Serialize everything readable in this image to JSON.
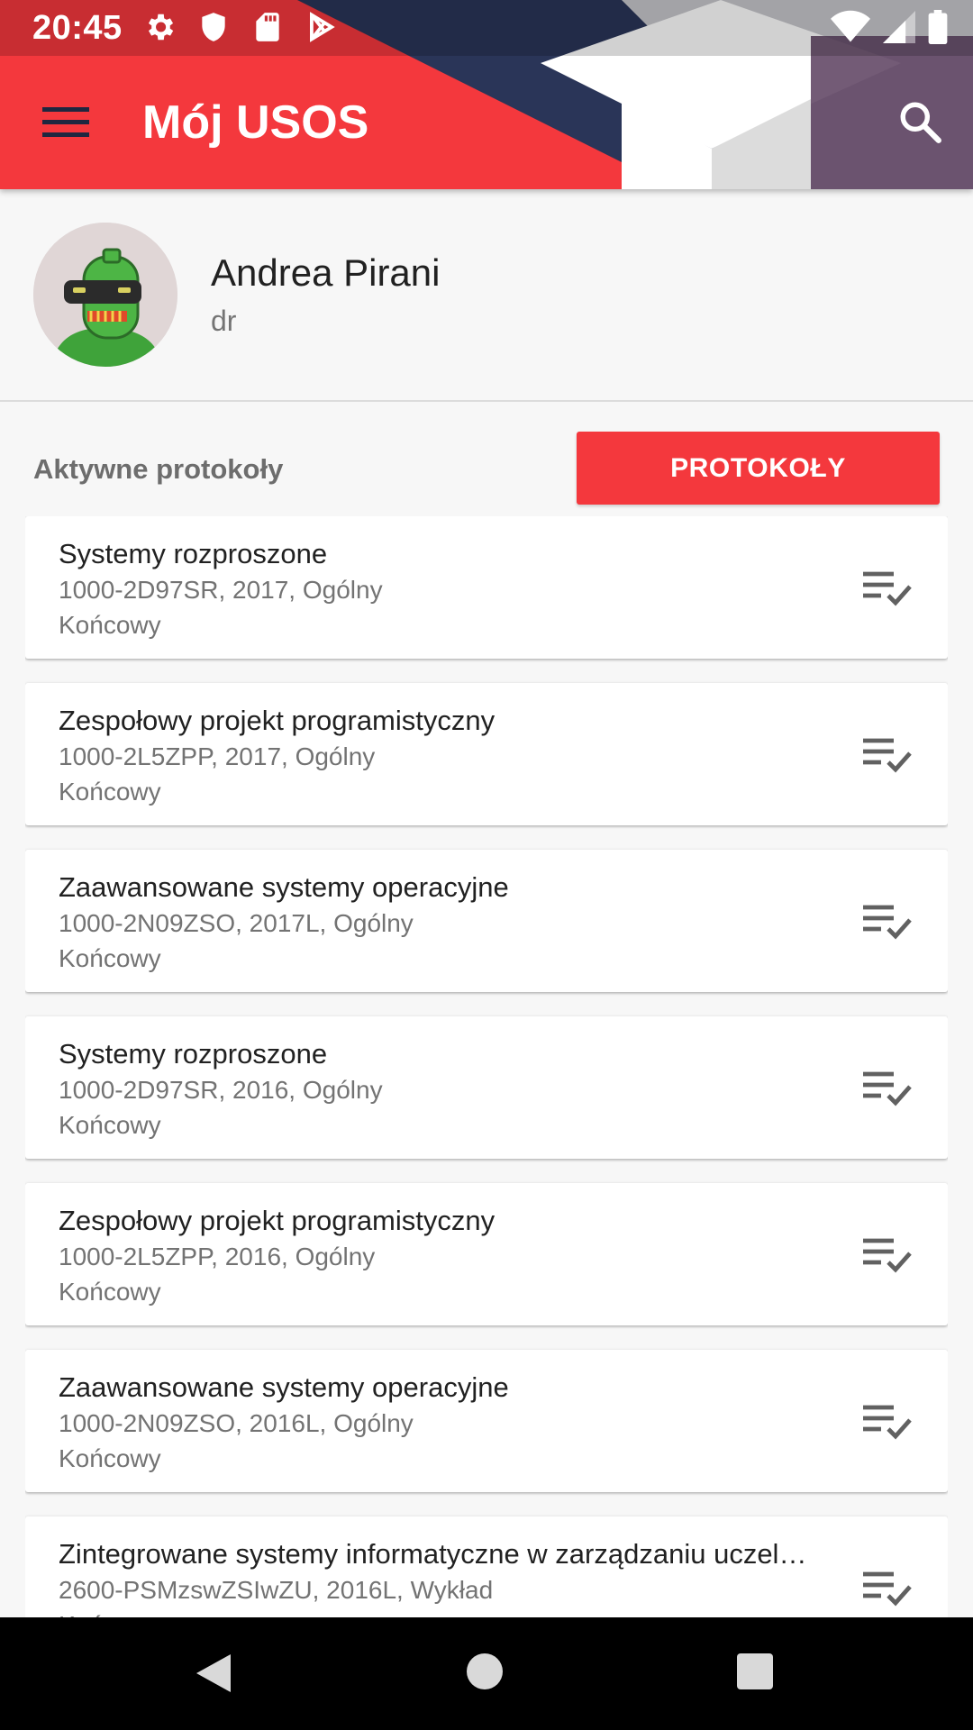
{
  "status_bar": {
    "time": "20:45",
    "icons_left": [
      "settings-icon",
      "shield-icon",
      "sd-card-icon",
      "play-store-icon"
    ],
    "icons_right": [
      "wifi-icon",
      "cell-signal-icon",
      "battery-icon"
    ]
  },
  "toolbar": {
    "title": "Mój USOS",
    "menu_icon": "hamburger-menu-icon",
    "search_icon": "search-icon"
  },
  "profile": {
    "name": "Andrea Pirani",
    "title": "dr"
  },
  "section": {
    "label": "Aktywne protokoły",
    "button_label": "PROTOKOŁY"
  },
  "cards": [
    {
      "title": "Systemy rozproszone",
      "subtitle": "1000-2D97SR, 2017, Ogólny",
      "kind": "Końcowy"
    },
    {
      "title": "Zespołowy projekt programistyczny",
      "subtitle": "1000-2L5ZPP, 2017, Ogólny",
      "kind": "Końcowy"
    },
    {
      "title": "Zaawansowane systemy operacyjne",
      "subtitle": "1000-2N09ZSO, 2017L, Ogólny",
      "kind": "Końcowy"
    },
    {
      "title": "Systemy rozproszone",
      "subtitle": "1000-2D97SR, 2016, Ogólny",
      "kind": "Końcowy"
    },
    {
      "title": "Zespołowy projekt programistyczny",
      "subtitle": "1000-2L5ZPP, 2016, Ogólny",
      "kind": "Końcowy"
    },
    {
      "title": "Zaawansowane systemy operacyjne",
      "subtitle": "1000-2N09ZSO, 2016L, Ogólny",
      "kind": "Końcowy"
    },
    {
      "title": "Zintegrowane systemy informatyczne w zarządzaniu uczel…",
      "subtitle": "2600-PSMzswZSIwZU, 2016L, Wykład",
      "kind": "Końcowy"
    }
  ],
  "nav_bar": {
    "icons": [
      "back-icon",
      "home-icon",
      "recents-icon"
    ]
  },
  "colors": {
    "accent": "#f4383d",
    "toolbar_red": "#f4383d",
    "dark_navy": "#2a3558"
  }
}
